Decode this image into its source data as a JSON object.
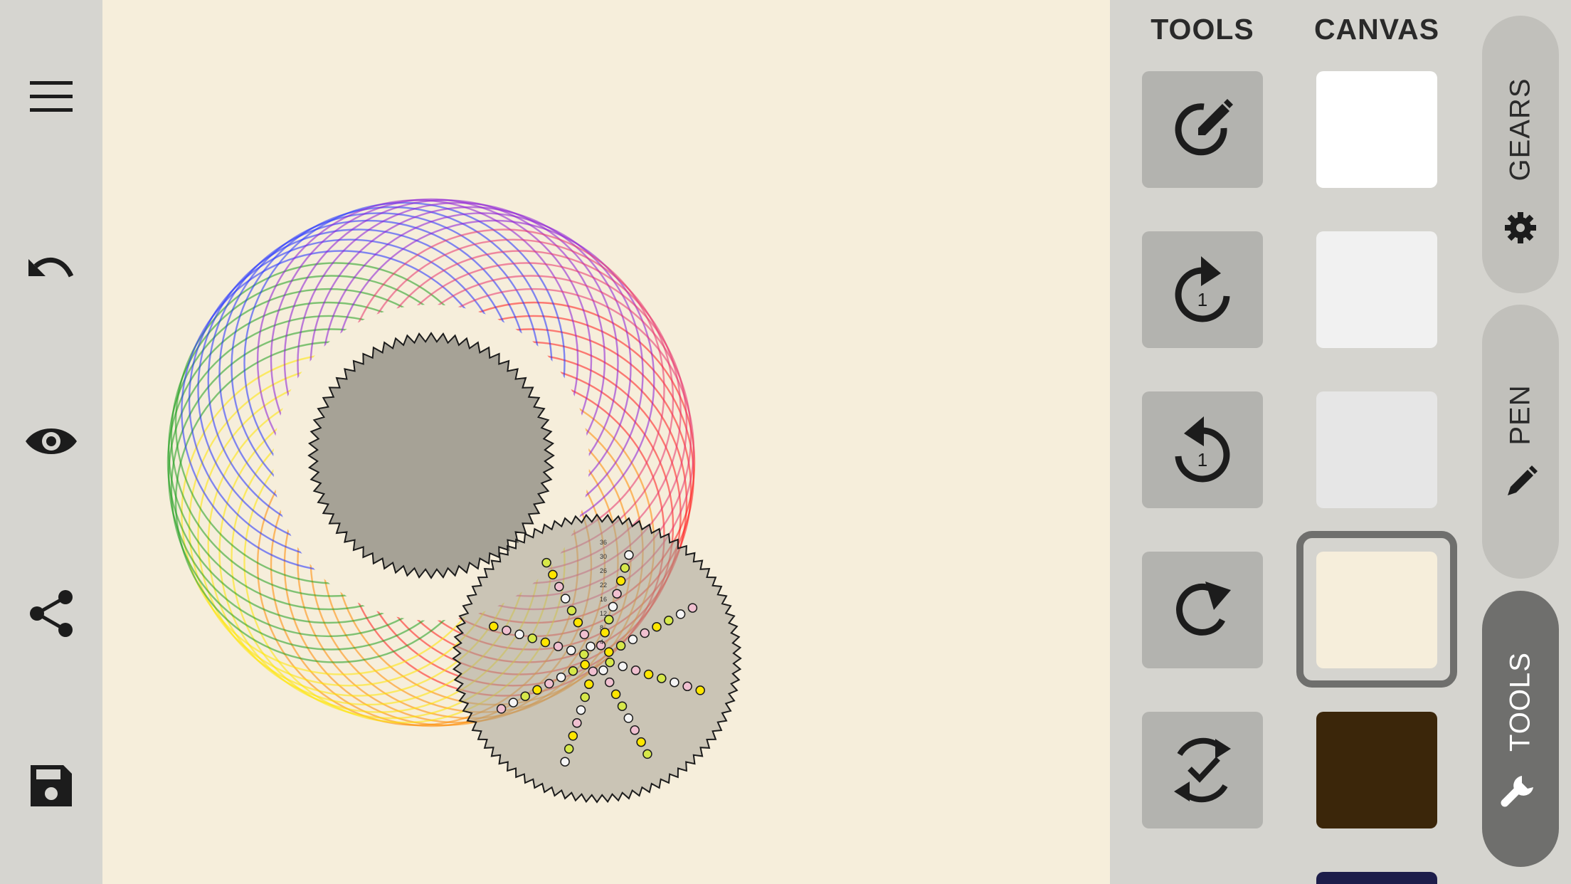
{
  "left_toolbar": {
    "buttons": [
      {
        "name": "menu-icon"
      },
      {
        "name": "undo-icon"
      },
      {
        "name": "eye-icon"
      },
      {
        "name": "share-icon"
      },
      {
        "name": "save-icon"
      }
    ]
  },
  "panel": {
    "tools_header": "TOOLS",
    "canvas_header": "CANVAS",
    "tools": [
      {
        "name": "draw-gear-icon"
      },
      {
        "name": "rotate-one-forward-icon",
        "badge": "1"
      },
      {
        "name": "rotate-one-back-icon",
        "badge": "1"
      },
      {
        "name": "redo-rotate-icon"
      },
      {
        "name": "auto-complete-icon"
      }
    ],
    "canvas_colors": [
      {
        "color": "#ffffff"
      },
      {
        "color": "#f1f1f1"
      },
      {
        "color": "#e6e6e6"
      },
      {
        "color": "#f6eedb",
        "selected": true
      },
      {
        "color": "#3b260a"
      }
    ]
  },
  "side_tabs": [
    {
      "label": "GEARS",
      "icon": "gear-icon"
    },
    {
      "label": "PEN",
      "icon": "pencil-icon"
    },
    {
      "label": "TOOLS",
      "icon": "wrench-icon",
      "active": true
    }
  ],
  "colors": {
    "canvas_background": "#f6eedb",
    "sidebar": "#d6d5d0",
    "panel": "#d5d4cf",
    "tool_button": "#b3b3af",
    "active_tab": "#6f6f6d",
    "gear_fill": "#a6a296"
  },
  "drawing": {
    "gear_hole_labels": [
      "36",
      "30",
      "26",
      "22",
      "16",
      "12",
      "8",
      "4"
    ]
  }
}
